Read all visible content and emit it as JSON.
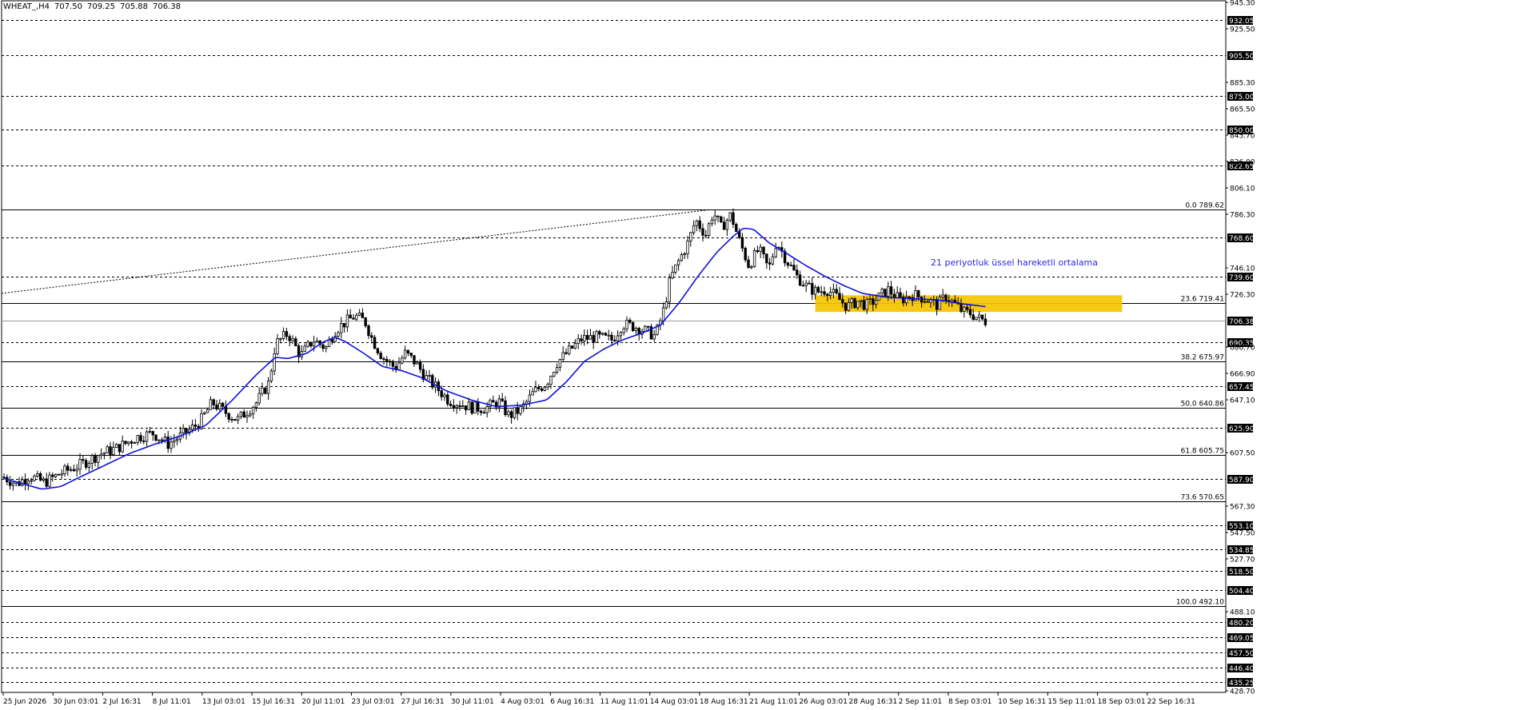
{
  "header": {
    "symbol": "WHEAT_,H4",
    "open": "707.50",
    "high": "709.25",
    "low": "705.88",
    "close": "706.38"
  },
  "colors": {
    "background": "#ffffff",
    "grid": "#000000",
    "candle": "#000000",
    "ema": "#1010dd",
    "highlight_zone": "#f5c400",
    "price_badge_bg": "#000000",
    "price_badge_fg": "#ffffff",
    "annotation_text": "#2a2ae0"
  },
  "annotation": "21 periyotluk üssel hareketli ortalama",
  "chart_data": {
    "type": "line",
    "subtype": "candlestick-with-ema",
    "title": "",
    "ylim": [
      428.7,
      945.3
    ],
    "y_axis_ticks": [
      "945.30",
      "925.50",
      "885.30",
      "865.50",
      "845.70",
      "826.00",
      "806.10",
      "786.30",
      "746.10",
      "726.30",
      "686.70",
      "666.90",
      "647.10",
      "607.50",
      "567.30",
      "547.50",
      "527.70",
      "488.10",
      "428.70"
    ],
    "dashed_levels": [
      {
        "label": "932.05",
        "value": 932.05
      },
      {
        "label": "905.50",
        "value": 905.5
      },
      {
        "label": "875.00",
        "value": 875.0
      },
      {
        "label": "850.00",
        "value": 850.0
      },
      {
        "label": "822.65",
        "value": 822.65
      },
      {
        "label": "768.60",
        "value": 768.6
      },
      {
        "label": "739.60",
        "value": 739.6
      },
      {
        "label": "690.35",
        "value": 690.35
      },
      {
        "label": "657.45",
        "value": 657.45
      },
      {
        "label": "625.90",
        "value": 625.9
      },
      {
        "label": "587.90",
        "value": 587.9
      },
      {
        "label": "553.10",
        "value": 553.1
      },
      {
        "label": "534.85",
        "value": 534.85
      },
      {
        "label": "518.50",
        "value": 518.5
      },
      {
        "label": "504.40",
        "value": 504.4
      },
      {
        "label": "480.20",
        "value": 480.2
      },
      {
        "label": "469.05",
        "value": 469.05
      },
      {
        "label": "457.50",
        "value": 457.5
      },
      {
        "label": "446.40",
        "value": 446.4
      },
      {
        "label": "435.25",
        "value": 435.25
      }
    ],
    "current_price": {
      "label": "706.38",
      "value": 706.38
    },
    "fibonacci": [
      {
        "label": "0.0 789.62",
        "value": 789.62
      },
      {
        "label": "23.6 719.41",
        "value": 719.41
      },
      {
        "label": "38.2 675.97",
        "value": 675.97
      },
      {
        "label": "50.0 640.86",
        "value": 640.86
      },
      {
        "label": "61.8 605.75",
        "value": 605.75
      },
      {
        "label": "73.6 570.65",
        "value": 570.65
      },
      {
        "label": "100.0 492.10",
        "value": 492.1
      }
    ],
    "fib_trend_line": {
      "from_value": 727.0,
      "to_value": 789.62
    },
    "highlight_zone": {
      "from_value": 713.0,
      "to_value": 725.5
    },
    "x_ticks": [
      "25 Jun 2026",
      "30 Jun 03:01",
      "2 Jul 16:31",
      "8 Jul 11:01",
      "13 Jul 03:01",
      "15 Jul 16:31",
      "20 Jul 11:01",
      "23 Jul 03:01",
      "27 Jul 16:31",
      "30 Jul 11:01",
      "4 Aug 03:01",
      "6 Aug 16:31",
      "11 Aug 11:01",
      "14 Aug 03:01",
      "18 Aug 16:31",
      "21 Aug 11:01",
      "26 Aug 03:01",
      "28 Aug 16:31",
      "2 Sep 11:01",
      "8 Sep 03:01",
      "10 Sep 16:31",
      "15 Sep 11:01",
      "18 Sep 03:01",
      "22 Sep 16:31"
    ],
    "bar_count": 324,
    "price_path": [
      [
        0,
        589
      ],
      [
        10,
        584
      ],
      [
        20,
        590
      ],
      [
        32,
        585
      ],
      [
        45,
        592
      ],
      [
        60,
        598
      ],
      [
        75,
        606
      ],
      [
        90,
        611
      ],
      [
        105,
        619
      ],
      [
        118,
        622
      ],
      [
        130,
        614
      ],
      [
        145,
        623
      ],
      [
        155,
        630
      ],
      [
        165,
        645
      ],
      [
        175,
        638
      ],
      [
        185,
        632
      ],
      [
        200,
        645
      ],
      [
        210,
        660
      ],
      [
        215,
        689
      ],
      [
        225,
        697
      ],
      [
        235,
        680
      ],
      [
        245,
        692
      ],
      [
        255,
        686
      ],
      [
        262,
        699
      ],
      [
        270,
        705
      ],
      [
        278,
        710
      ],
      [
        286,
        706
      ],
      [
        292,
        692
      ],
      [
        300,
        679
      ],
      [
        310,
        671
      ],
      [
        318,
        682
      ],
      [
        326,
        675
      ],
      [
        335,
        663
      ],
      [
        345,
        654
      ],
      [
        352,
        647
      ],
      [
        362,
        644
      ],
      [
        372,
        641
      ],
      [
        382,
        641
      ],
      [
        392,
        646
      ],
      [
        400,
        635
      ],
      [
        410,
        640
      ],
      [
        420,
        653
      ],
      [
        430,
        660
      ],
      [
        438,
        675
      ],
      [
        448,
        684
      ],
      [
        458,
        693
      ],
      [
        470,
        694
      ],
      [
        482,
        692
      ],
      [
        490,
        704
      ],
      [
        500,
        702
      ],
      [
        510,
        698
      ],
      [
        516,
        695
      ],
      [
        522,
        712
      ],
      [
        528,
        738
      ],
      [
        534,
        750
      ],
      [
        542,
        765
      ],
      [
        548,
        782
      ],
      [
        556,
        771
      ],
      [
        562,
        788
      ],
      [
        568,
        776
      ],
      [
        576,
        786
      ],
      [
        582,
        768
      ],
      [
        590,
        748
      ],
      [
        598,
        760
      ],
      [
        606,
        745
      ],
      [
        612,
        766
      ],
      [
        620,
        752
      ],
      [
        628,
        740
      ],
      [
        636,
        732
      ],
      [
        644,
        728
      ],
      [
        652,
        730
      ],
      [
        660,
        724
      ],
      [
        668,
        717
      ],
      [
        676,
        721
      ],
      [
        684,
        718
      ],
      [
        692,
        723
      ],
      [
        700,
        730
      ],
      [
        710,
        722
      ],
      [
        720,
        726
      ],
      [
        730,
        723
      ],
      [
        740,
        718
      ],
      [
        746,
        725
      ],
      [
        752,
        720
      ],
      [
        760,
        713
      ],
      [
        766,
        712
      ],
      [
        772,
        708
      ],
      [
        778,
        706
      ]
    ],
    "ema_path": [
      [
        0,
        588
      ],
      [
        15,
        584
      ],
      [
        30,
        580
      ],
      [
        45,
        582
      ],
      [
        60,
        589
      ],
      [
        80,
        598
      ],
      [
        100,
        607
      ],
      [
        120,
        614
      ],
      [
        140,
        620
      ],
      [
        160,
        628
      ],
      [
        180,
        646
      ],
      [
        200,
        666
      ],
      [
        215,
        679
      ],
      [
        225,
        678
      ],
      [
        240,
        682
      ],
      [
        252,
        690
      ],
      [
        262,
        694
      ],
      [
        270,
        691
      ],
      [
        285,
        682
      ],
      [
        300,
        672
      ],
      [
        315,
        669
      ],
      [
        330,
        664
      ],
      [
        350,
        654
      ],
      [
        370,
        647
      ],
      [
        390,
        642
      ],
      [
        410,
        643
      ],
      [
        430,
        647
      ],
      [
        445,
        660
      ],
      [
        460,
        676
      ],
      [
        475,
        685
      ],
      [
        490,
        692
      ],
      [
        505,
        697
      ],
      [
        520,
        703
      ],
      [
        535,
        720
      ],
      [
        550,
        740
      ],
      [
        565,
        758
      ],
      [
        578,
        770
      ],
      [
        586,
        776
      ],
      [
        594,
        775
      ],
      [
        606,
        765
      ],
      [
        620,
        757
      ],
      [
        635,
        748
      ],
      [
        650,
        740
      ],
      [
        665,
        733
      ],
      [
        680,
        727
      ],
      [
        700,
        724
      ],
      [
        720,
        723
      ],
      [
        740,
        722
      ],
      [
        760,
        719
      ],
      [
        778,
        717
      ]
    ]
  }
}
